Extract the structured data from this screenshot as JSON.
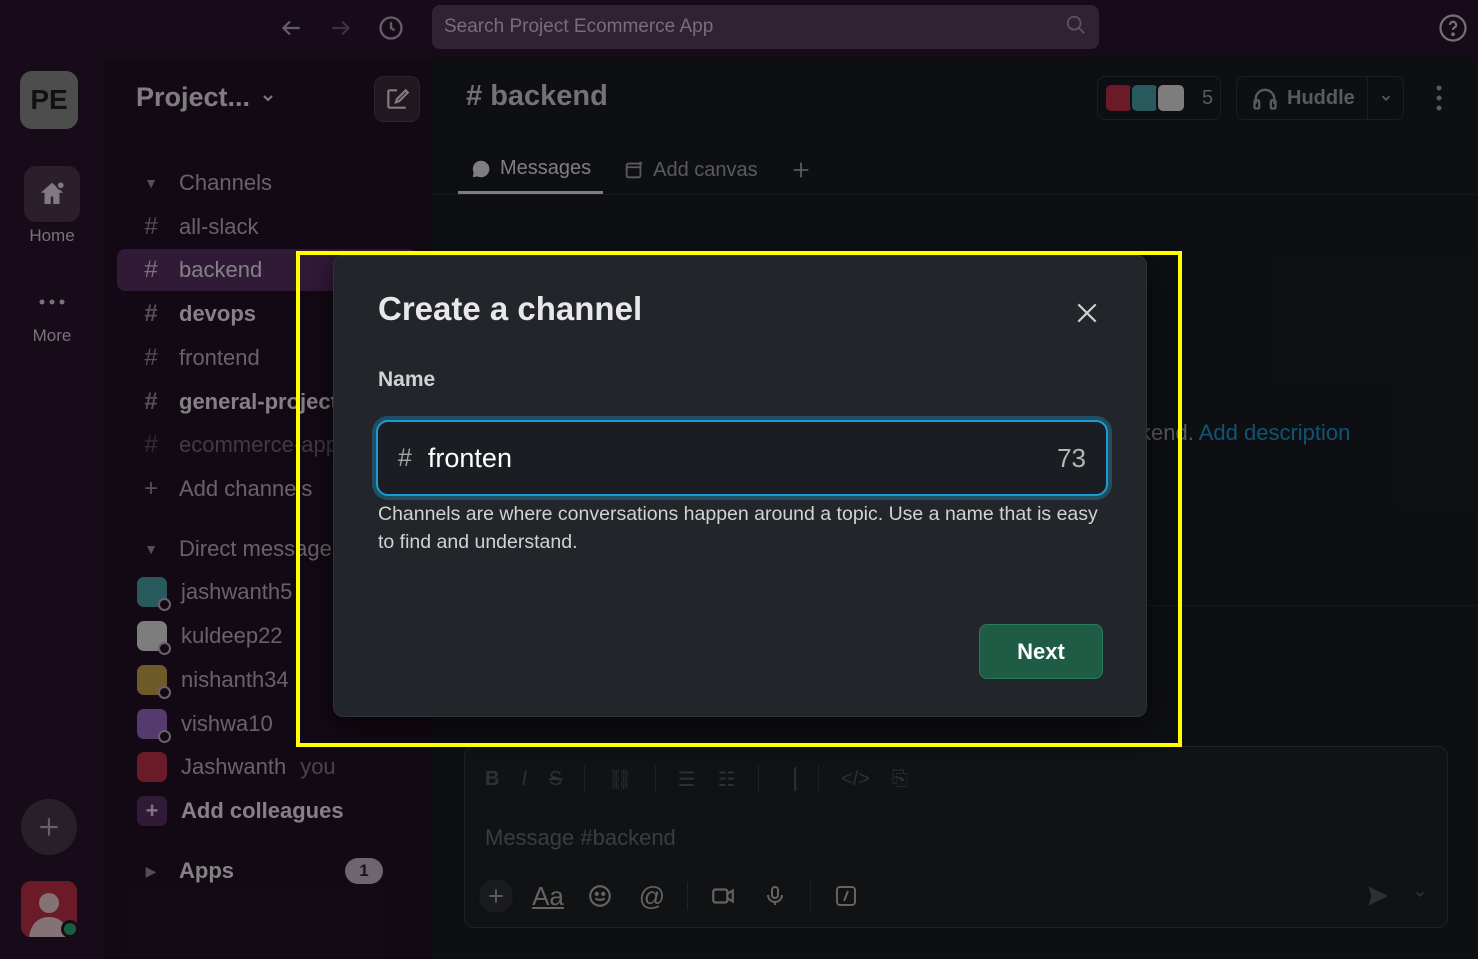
{
  "topbar": {
    "search_placeholder": "Search Project Ecommerce App"
  },
  "rail": {
    "workspace_initials": "PE",
    "home_label": "Home",
    "more_label": "More"
  },
  "sidebar": {
    "workspace_name": "Project...",
    "channels_header": "Channels",
    "channels": [
      {
        "name": "all-slack",
        "state": "normal"
      },
      {
        "name": "backend",
        "state": "active"
      },
      {
        "name": "devops",
        "state": "bold"
      },
      {
        "name": "frontend",
        "state": "normal"
      },
      {
        "name": "general-project",
        "state": "bold"
      },
      {
        "name": "ecommerce-app",
        "state": "dim"
      }
    ],
    "add_channels": "Add channels",
    "dm_header": "Direct messages",
    "dms": [
      {
        "name": "jashwanth5",
        "color": "#4aa3a8"
      },
      {
        "name": "kuldeep22",
        "color": "#e3e3e3"
      },
      {
        "name": "nishanth34",
        "color": "#c9a44a"
      },
      {
        "name": "vishwa10",
        "color": "#9b6bc6"
      },
      {
        "name": "Jashwanth",
        "color": "#c4304a",
        "suffix": "you"
      }
    ],
    "add_colleagues": "Add colleagues",
    "apps_label": "Apps",
    "apps_badge": "1"
  },
  "channel": {
    "hash": "#",
    "name": "backend",
    "member_count": "5",
    "huddle_label": "Huddle",
    "tabs": [
      "Messages",
      "Add canvas"
    ],
    "intro_fragment": "kend.",
    "add_description": "Add description",
    "message_placeholder": "Message #backend",
    "aa_label": "Aa"
  },
  "modal": {
    "title": "Create a channel",
    "field_label": "Name",
    "input_prefix": "#",
    "input_value": "fronten",
    "char_remaining": "73",
    "hint": "Channels are where conversations happen around a topic. Use a name that is easy to find and understand.",
    "next_label": "Next"
  },
  "colors": {
    "accent_blue": "#1d9bd1",
    "next_green": "#1f5c45",
    "highlight": "#ffff00",
    "sidebar_active": "#5a2f66"
  }
}
